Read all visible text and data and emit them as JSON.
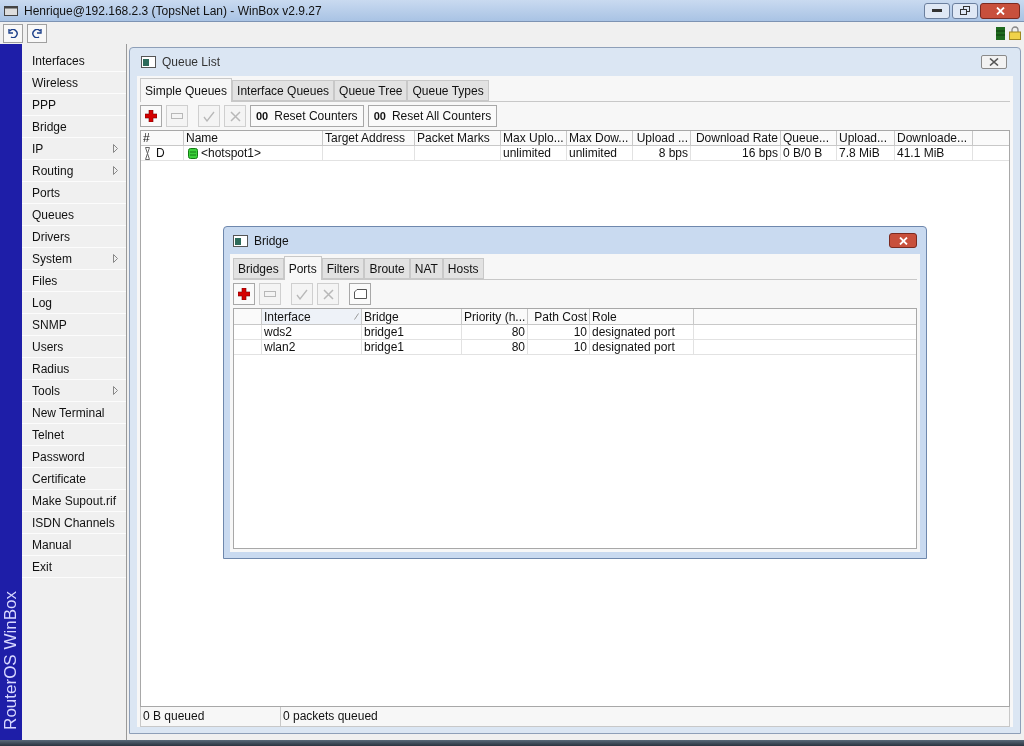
{
  "window": {
    "title": "Henrique@192.168.2.3 (TopsNet Lan) - WinBox v2.9.27"
  },
  "toolbar": {
    "buttons": [
      {
        "kind": "undo"
      },
      {
        "kind": "redo"
      }
    ]
  },
  "sidebar": {
    "brand": "RouterOS WinBox",
    "items": [
      {
        "label": "Interfaces",
        "has_submenu": false
      },
      {
        "label": "Wireless",
        "has_submenu": false
      },
      {
        "label": "PPP",
        "has_submenu": false
      },
      {
        "label": "Bridge",
        "has_submenu": false
      },
      {
        "label": "IP",
        "has_submenu": true
      },
      {
        "label": "Routing",
        "has_submenu": true
      },
      {
        "label": "Ports",
        "has_submenu": false
      },
      {
        "label": "Queues",
        "has_submenu": false
      },
      {
        "label": "Drivers",
        "has_submenu": false
      },
      {
        "label": "System",
        "has_submenu": true
      },
      {
        "label": "Files",
        "has_submenu": false
      },
      {
        "label": "Log",
        "has_submenu": false
      },
      {
        "label": "SNMP",
        "has_submenu": false
      },
      {
        "label": "Users",
        "has_submenu": false
      },
      {
        "label": "Radius",
        "has_submenu": false
      },
      {
        "label": "Tools",
        "has_submenu": true
      },
      {
        "label": "New Terminal",
        "has_submenu": false
      },
      {
        "label": "Telnet",
        "has_submenu": false
      },
      {
        "label": "Password",
        "has_submenu": false
      },
      {
        "label": "Certificate",
        "has_submenu": false
      },
      {
        "label": "Make Supout.rif",
        "has_submenu": false
      },
      {
        "label": "ISDN Channels",
        "has_submenu": false
      },
      {
        "label": "Manual",
        "has_submenu": false
      },
      {
        "label": "Exit",
        "has_submenu": false
      }
    ]
  },
  "queue_list": {
    "title": "Queue List",
    "tabs": [
      {
        "label": "Simple Queues",
        "selected": true
      },
      {
        "label": "Interface Queues",
        "selected": false
      },
      {
        "label": "Queue Tree",
        "selected": false
      },
      {
        "label": "Queue Types",
        "selected": false
      }
    ],
    "tools": [
      {
        "kind": "add",
        "disabled": false
      },
      {
        "kind": "remove",
        "disabled": true
      },
      {
        "kind": "enable",
        "disabled": true
      },
      {
        "kind": "disable",
        "disabled": true
      }
    ],
    "actions": [
      {
        "prefix": "00",
        "label": "Reset Counters"
      },
      {
        "prefix": "00",
        "label": "Reset All Counters"
      }
    ],
    "table": {
      "columns": [
        "#",
        "Name",
        "Target Address",
        "Packet Marks",
        "Max Uplo...",
        "Max Dow...",
        "Upload ...",
        "Download Rate",
        "Queue...",
        "Upload...",
        "Downloade..."
      ],
      "rows": [
        {
          "cells": [
            "D",
            "<hotspot1>",
            "",
            "",
            "unlimited",
            "unlimited",
            "8 bps",
            "16 bps",
            "0 B/0 B",
            "7.8 MiB",
            "41.1 MiB"
          ]
        }
      ]
    },
    "status_bar": [
      "0 B queued",
      "0 packets queued"
    ]
  },
  "bridge": {
    "title": "Bridge",
    "tabs": [
      {
        "label": "Bridges",
        "selected": false
      },
      {
        "label": "Ports",
        "selected": true
      },
      {
        "label": "Filters",
        "selected": false
      },
      {
        "label": "Broute",
        "selected": false
      },
      {
        "label": "NAT",
        "selected": false
      },
      {
        "label": "Hosts",
        "selected": false
      }
    ],
    "tools": [
      {
        "kind": "add",
        "disabled": false
      },
      {
        "kind": "remove",
        "disabled": true
      },
      {
        "kind": "enable",
        "disabled": true
      },
      {
        "kind": "disable",
        "disabled": true
      },
      {
        "kind": "comment",
        "disabled": false
      }
    ],
    "table": {
      "columns": [
        {
          "label": "Interface",
          "sorted": true
        },
        {
          "label": "Bridge",
          "sorted": false
        },
        {
          "label": "Priority (h...",
          "sorted": false
        },
        {
          "label": "Path Cost",
          "sorted": false
        },
        {
          "label": "Role",
          "sorted": false
        }
      ],
      "rows": [
        [
          "wds2",
          "bridge1",
          "80",
          "10",
          "designated port"
        ],
        [
          "wlan2",
          "bridge1",
          "80",
          "10",
          "designated port"
        ]
      ]
    }
  }
}
